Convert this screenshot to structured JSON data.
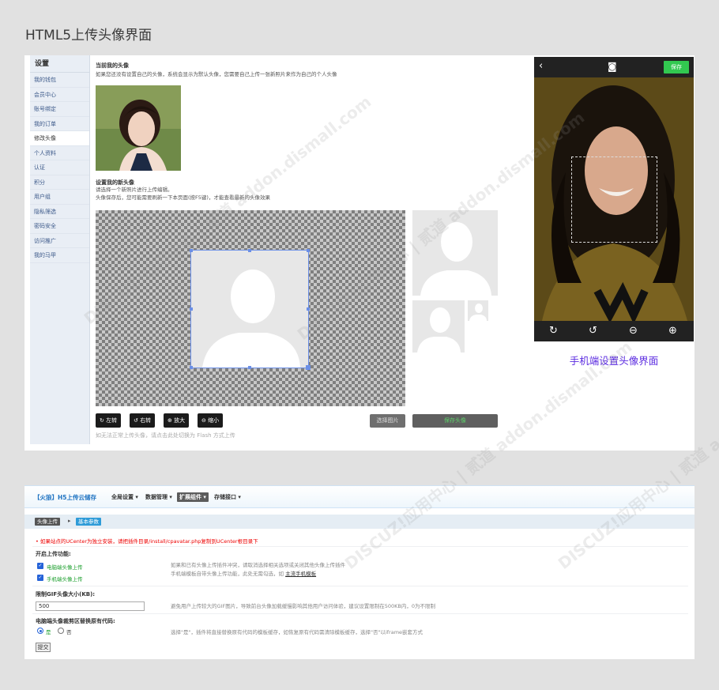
{
  "page_title": "HTML5上传头像界面",
  "sidebar": {
    "title": "设置",
    "items": [
      {
        "label": "我的钱包"
      },
      {
        "label": "会员中心"
      },
      {
        "label": "账号绑定"
      },
      {
        "label": "我的订单"
      },
      {
        "label": "修改头像",
        "active": true
      },
      {
        "label": "个人资料"
      },
      {
        "label": "认证"
      },
      {
        "label": "积分"
      },
      {
        "label": "用户组"
      },
      {
        "label": "隐私筛选"
      },
      {
        "label": "密码安全"
      },
      {
        "label": "访问推广"
      },
      {
        "label": "我的马甲"
      }
    ]
  },
  "avatar": {
    "current_title": "当前我的头像",
    "current_desc": "如果您还没有设置自己的头像，系统会显示为默认头像，您需要自己上传一张新照片来作为自己的个人头像",
    "new_title": "设置我的新头像",
    "new_desc1": "请选择一个新照片进行上传编辑。",
    "new_desc2": "头像保存后，您可能需要刷新一下本页面(按F5键)，才能查看最新的头像效果",
    "buttons": {
      "rotate_left": "左转",
      "rotate_right": "右转",
      "zoom_in": "放大",
      "zoom_out": "缩小",
      "choose": "选择图片",
      "save": "保存头像"
    },
    "flash_note": "如无法正常上传头像，请点击此处切换为 Flash 方式上传"
  },
  "phone": {
    "save": "保存",
    "caption": "手机端设置头像界面"
  },
  "admin": {
    "plugin_name": "【火狼】H5上传云储存",
    "menu": [
      "全局设置 ▾",
      "数据管理 ▾",
      "扩展组件 ▾",
      "存储接口 ▾"
    ],
    "crumb_a": "头像上传",
    "crumb_b": "基本参数",
    "warning": "如果站点的UCenter为独立安装，请把插件目录/install/cpavatar.php复制到UCenter根目录下",
    "upload_label": "开启上传功能:",
    "pc_upload": "电脑端头像上传",
    "mobile_upload": "手机端头像上传",
    "upload_note1": "如果和已有头像上传插件冲突，请取消选择相关选项或关闭其他头像上传插件",
    "upload_note2": "手机端模板自带头像上传功能，此处无需勾选，如",
    "upload_note2_link": "主流手机模板",
    "gif_label": "限制GIF头像大小(KB):",
    "gif_value": "500",
    "gif_note": "避免用户上传较大的GIF图片，导致前台头像加载缓慢影响其他用户访问体验，建议设置限制在500KB内，0为不限制",
    "replace_label": "电脑端头像裁剪区替换原有代码:",
    "yes": "是",
    "no": "否",
    "replace_note": "选择\"是\"，插件将直接替换原有代码的模板缓存，如恢复原有代码需清除模板缓存，选择\"否\"以iframe嵌套方式",
    "submit": "提交"
  },
  "watermark": "DISCUZ!应用中心 | 贰道  addon.dismall.com"
}
